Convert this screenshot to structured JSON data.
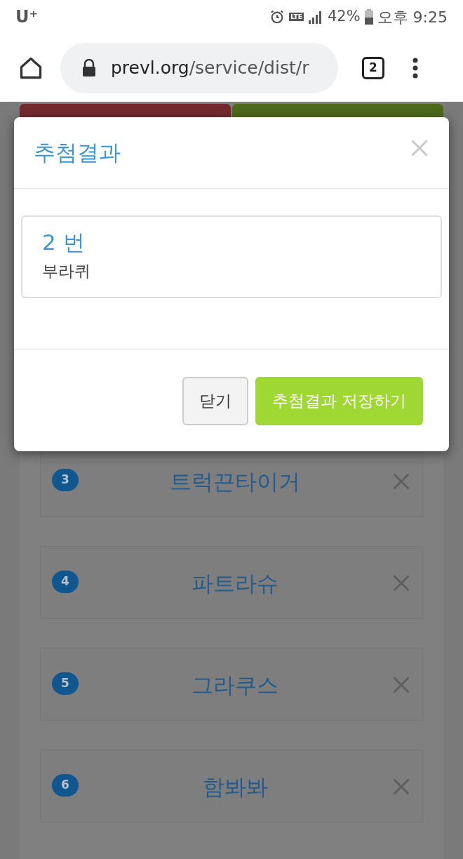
{
  "status_bar": {
    "carrier": "U⁺",
    "lte": "LTE",
    "battery": "42%",
    "time": "오후 9:25"
  },
  "browser": {
    "url_host": "prevl.org",
    "url_path": "/service/dist/r",
    "tab_count": "2"
  },
  "list": [
    {
      "number": "3",
      "name": "트럭끈타이거"
    },
    {
      "number": "4",
      "name": "파트라슈"
    },
    {
      "number": "5",
      "name": "그라쿠스"
    },
    {
      "number": "6",
      "name": "함봐봐"
    }
  ],
  "modal": {
    "title": "추첨결과",
    "result": {
      "number": "2 번",
      "name": "부라퀴"
    },
    "buttons": [
      {
        "label": "닫기",
        "kind": "secondary"
      },
      {
        "label": "추첨결과 저장하기",
        "kind": "primary"
      }
    ]
  }
}
